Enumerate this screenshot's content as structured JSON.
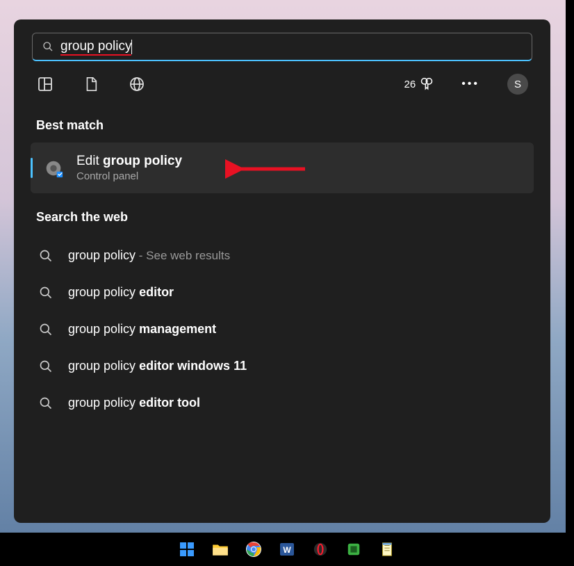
{
  "search": {
    "query": "group policy"
  },
  "rewards": {
    "count": "26"
  },
  "avatar": {
    "initial": "S"
  },
  "sections": {
    "best_match": "Best match",
    "web": "Search the web"
  },
  "best_match": {
    "title_prefix": "Edit ",
    "title_bold": "group policy",
    "subtitle": "Control panel"
  },
  "web_results": [
    {
      "plain": "group policy",
      "bold": "",
      "hint": " - See web results"
    },
    {
      "plain": "group policy ",
      "bold": "editor",
      "hint": ""
    },
    {
      "plain": "group policy ",
      "bold": "management",
      "hint": ""
    },
    {
      "plain": "group policy ",
      "bold": "editor windows 11",
      "hint": ""
    },
    {
      "plain": "group policy ",
      "bold": "editor tool",
      "hint": ""
    }
  ]
}
